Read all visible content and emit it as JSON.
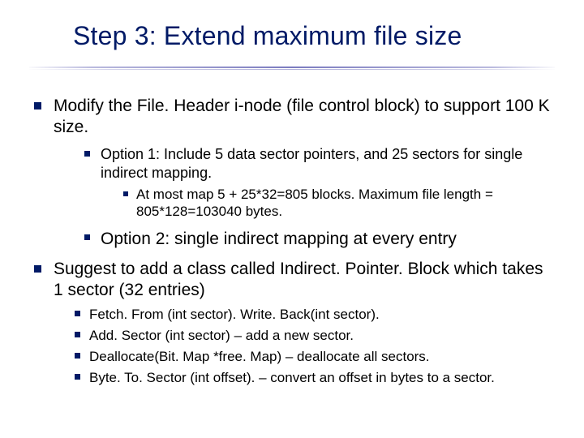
{
  "title": "Step 3: Extend maximum file size",
  "bullets": {
    "b1": "Modify the File. Header i-node (file control block) to support 100 K size.",
    "b1_sub": {
      "opt1": " Option 1: Include 5 data sector pointers, and  25 sectors for single indirect mapping.",
      "opt1_detail": "At most map  5 + 25*32=805 blocks. Maximum file length = 805*128=103040 bytes.",
      "opt2": "Option 2: single indirect mapping at every entry"
    },
    "b2": "Suggest to add a class called  Indirect. Pointer. Block which takes 1 sector (32 entries)",
    "b2_sub": {
      "m1": "Fetch. From (int sector).  Write. Back(int sector).",
      "m2": "Add. Sector (int sector) – add a new sector.",
      "m3": "Deallocate(Bit. Map *free. Map) – deallocate all sectors.",
      "m4": "Byte. To. Sector (int offset). – convert an offset in bytes  to a sector."
    }
  }
}
